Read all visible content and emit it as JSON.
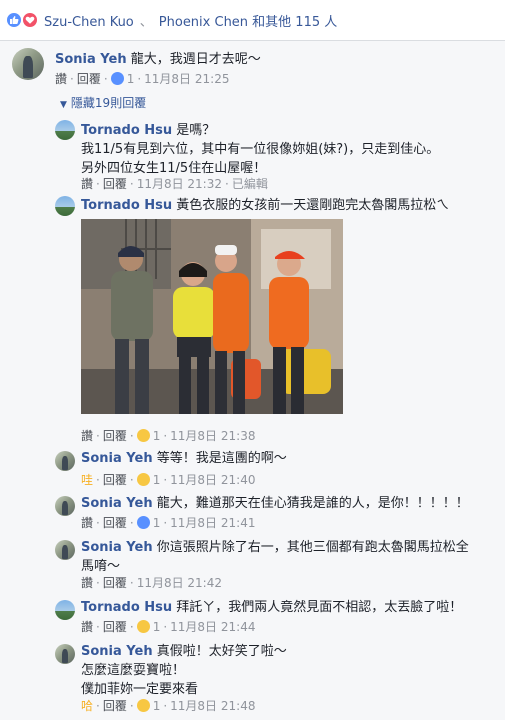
{
  "reactions": {
    "names": "Szu-Chen Kuo",
    "separator": "、",
    "others": "Phoenix Chen 和其他 115 人"
  },
  "actions": {
    "like": "讚",
    "reply": "回覆",
    "wow": "哇",
    "haha": "哈",
    "dot": "·",
    "edited": "已編輯"
  },
  "top_comment": {
    "author": "Sonia Yeh",
    "text": "龍大，我週日才去呢～",
    "reaction_count": "1",
    "time": "11月8日 21:25"
  },
  "hidden_replies": "隱藏19則回覆",
  "replies": [
    {
      "author": "Tornado Hsu",
      "lines": [
        "是嗎？",
        "我11/5有見到六位，其中有一位很像妳姐(妹?)，只走到佳心。",
        "另外四位女生11/5住在山屋喔！"
      ],
      "time": "11月8日 21:32",
      "edited": true
    },
    {
      "author": "Tornado Hsu",
      "lines": [
        "黃色衣服的女孩前一天還剛跑完太魯閣馬拉松ㄟ"
      ],
      "reaction_count": "1",
      "time": "11月8日 21:38",
      "has_photo": true
    },
    {
      "author": "Sonia Yeh",
      "lines": [
        "等等！我是這團的啊～"
      ],
      "reaction_count": "1",
      "time": "11月8日 21:40",
      "first_action": "哇"
    },
    {
      "author": "Sonia Yeh",
      "lines": [
        "龍大，難道那天在佳心猜我是誰的人，是你！！！！！"
      ],
      "reaction_count": "1",
      "time": "11月8日 21:41"
    },
    {
      "author": "Sonia Yeh",
      "lines": [
        "你這張照片除了右一，其他三個都有跑太魯閣馬拉松全",
        "馬唷～"
      ],
      "time": "11月8日 21:42"
    },
    {
      "author": "Tornado Hsu",
      "lines": [
        "拜託ㄚ，我們兩人竟然見面不相認，太丟臉了啦！"
      ],
      "reaction_count": "1",
      "time": "11月8日 21:44"
    },
    {
      "author": "Sonia Yeh",
      "lines": [
        "真假啦！太好笑了啦～",
        "怎麼這麼耍寶啦！",
        "僕加菲妳一定要來看"
      ],
      "reaction_count": "1",
      "time": "11月8日 21:48",
      "first_action": "哈"
    }
  ]
}
